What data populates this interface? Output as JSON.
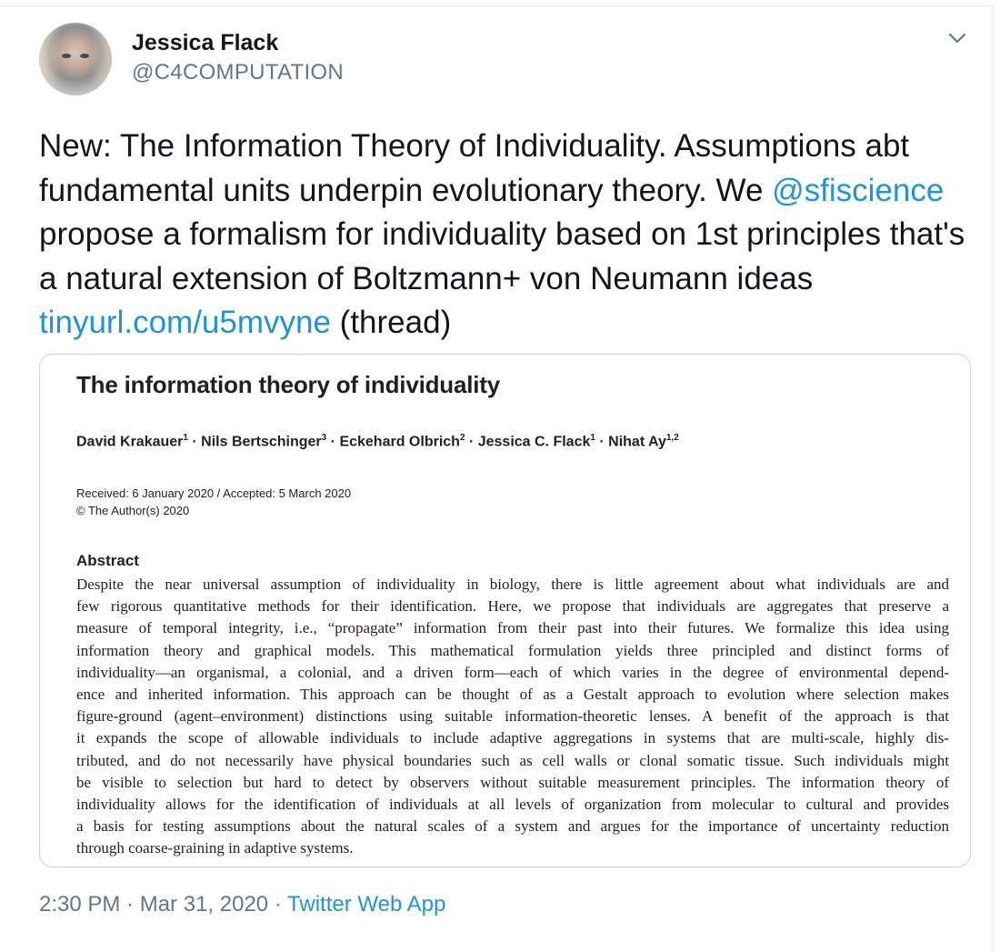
{
  "author": {
    "name": "Jessica Flack",
    "handle": "@C4COMPUTATION"
  },
  "menu_icon": "chevron-down-icon",
  "tweet": {
    "part1": "New: The Information Theory of Individuality. Assumptions abt fundamental units underpin evolutionary theory. We ",
    "mention": "@sfiscience",
    "part2": " propose a formalism for individuality based on 1st principles that's a natural extension of Boltzmann+ von Neumann ideas ",
    "url": "tinyurl.com/u5mvyne",
    "part3": " (thread)"
  },
  "card": {
    "title": "The information theory of individuality",
    "authors": [
      {
        "name": "David Krakauer",
        "sup": "1"
      },
      {
        "name": "Nils Bertschinger",
        "sup": "3"
      },
      {
        "name": "Eckehard Olbrich",
        "sup": "2"
      },
      {
        "name": "Jessica C. Flack",
        "sup": "1"
      },
      {
        "name": "Nihat Ay",
        "sup": "1,2"
      }
    ],
    "separator": " · ",
    "received": "Received: 6 January 2020 / Accepted: 5 March 2020",
    "copyright": "© The Author(s) 2020",
    "abstract_heading": "Abstract",
    "abstract_lines": [
      "Despite the near universal assumption of individuality in biology, there is little agreement about what individuals are and",
      "few rigorous quantitative methods for their identification. Here, we propose that individuals are aggregates that preserve a",
      "measure of temporal integrity, i.e., “propagate” information from their past into their futures. We formalize this idea using",
      "information theory and graphical models. This mathematical formulation yields three principled and distinct forms of",
      "individuality—an organismal, a colonial, and a driven form—each of which varies in the degree of environmental depend-",
      "ence and inherited information. This approach can be thought of as a Gestalt approach to evolution where selection makes",
      "figure-ground (agent–environment) distinctions using suitable information-theoretic lenses. A benefit of the approach is that",
      "it expands the scope of allowable individuals to include adaptive aggregations in systems that are multi-scale, highly dis-",
      "tributed, and do not necessarily have physical boundaries such as cell walls or clonal somatic tissue. Such individuals might",
      "be visible to selection but hard to detect by observers without suitable measurement principles. The information theory of",
      "individuality allows for the identification of individuals at all levels of organization from molecular to cultural and provides",
      "a basis for testing assumptions about the natural scales of a system and argues for the importance of uncertainty reduction",
      "through coarse-graining in adaptive systems."
    ]
  },
  "footer": {
    "time": "2:30 PM",
    "dot": " · ",
    "date": "Mar 31, 2020",
    "app": "Twitter Web App"
  },
  "colors": {
    "link": "#1b95e0",
    "secondary": "#657786",
    "border": "#ccd6dd"
  }
}
